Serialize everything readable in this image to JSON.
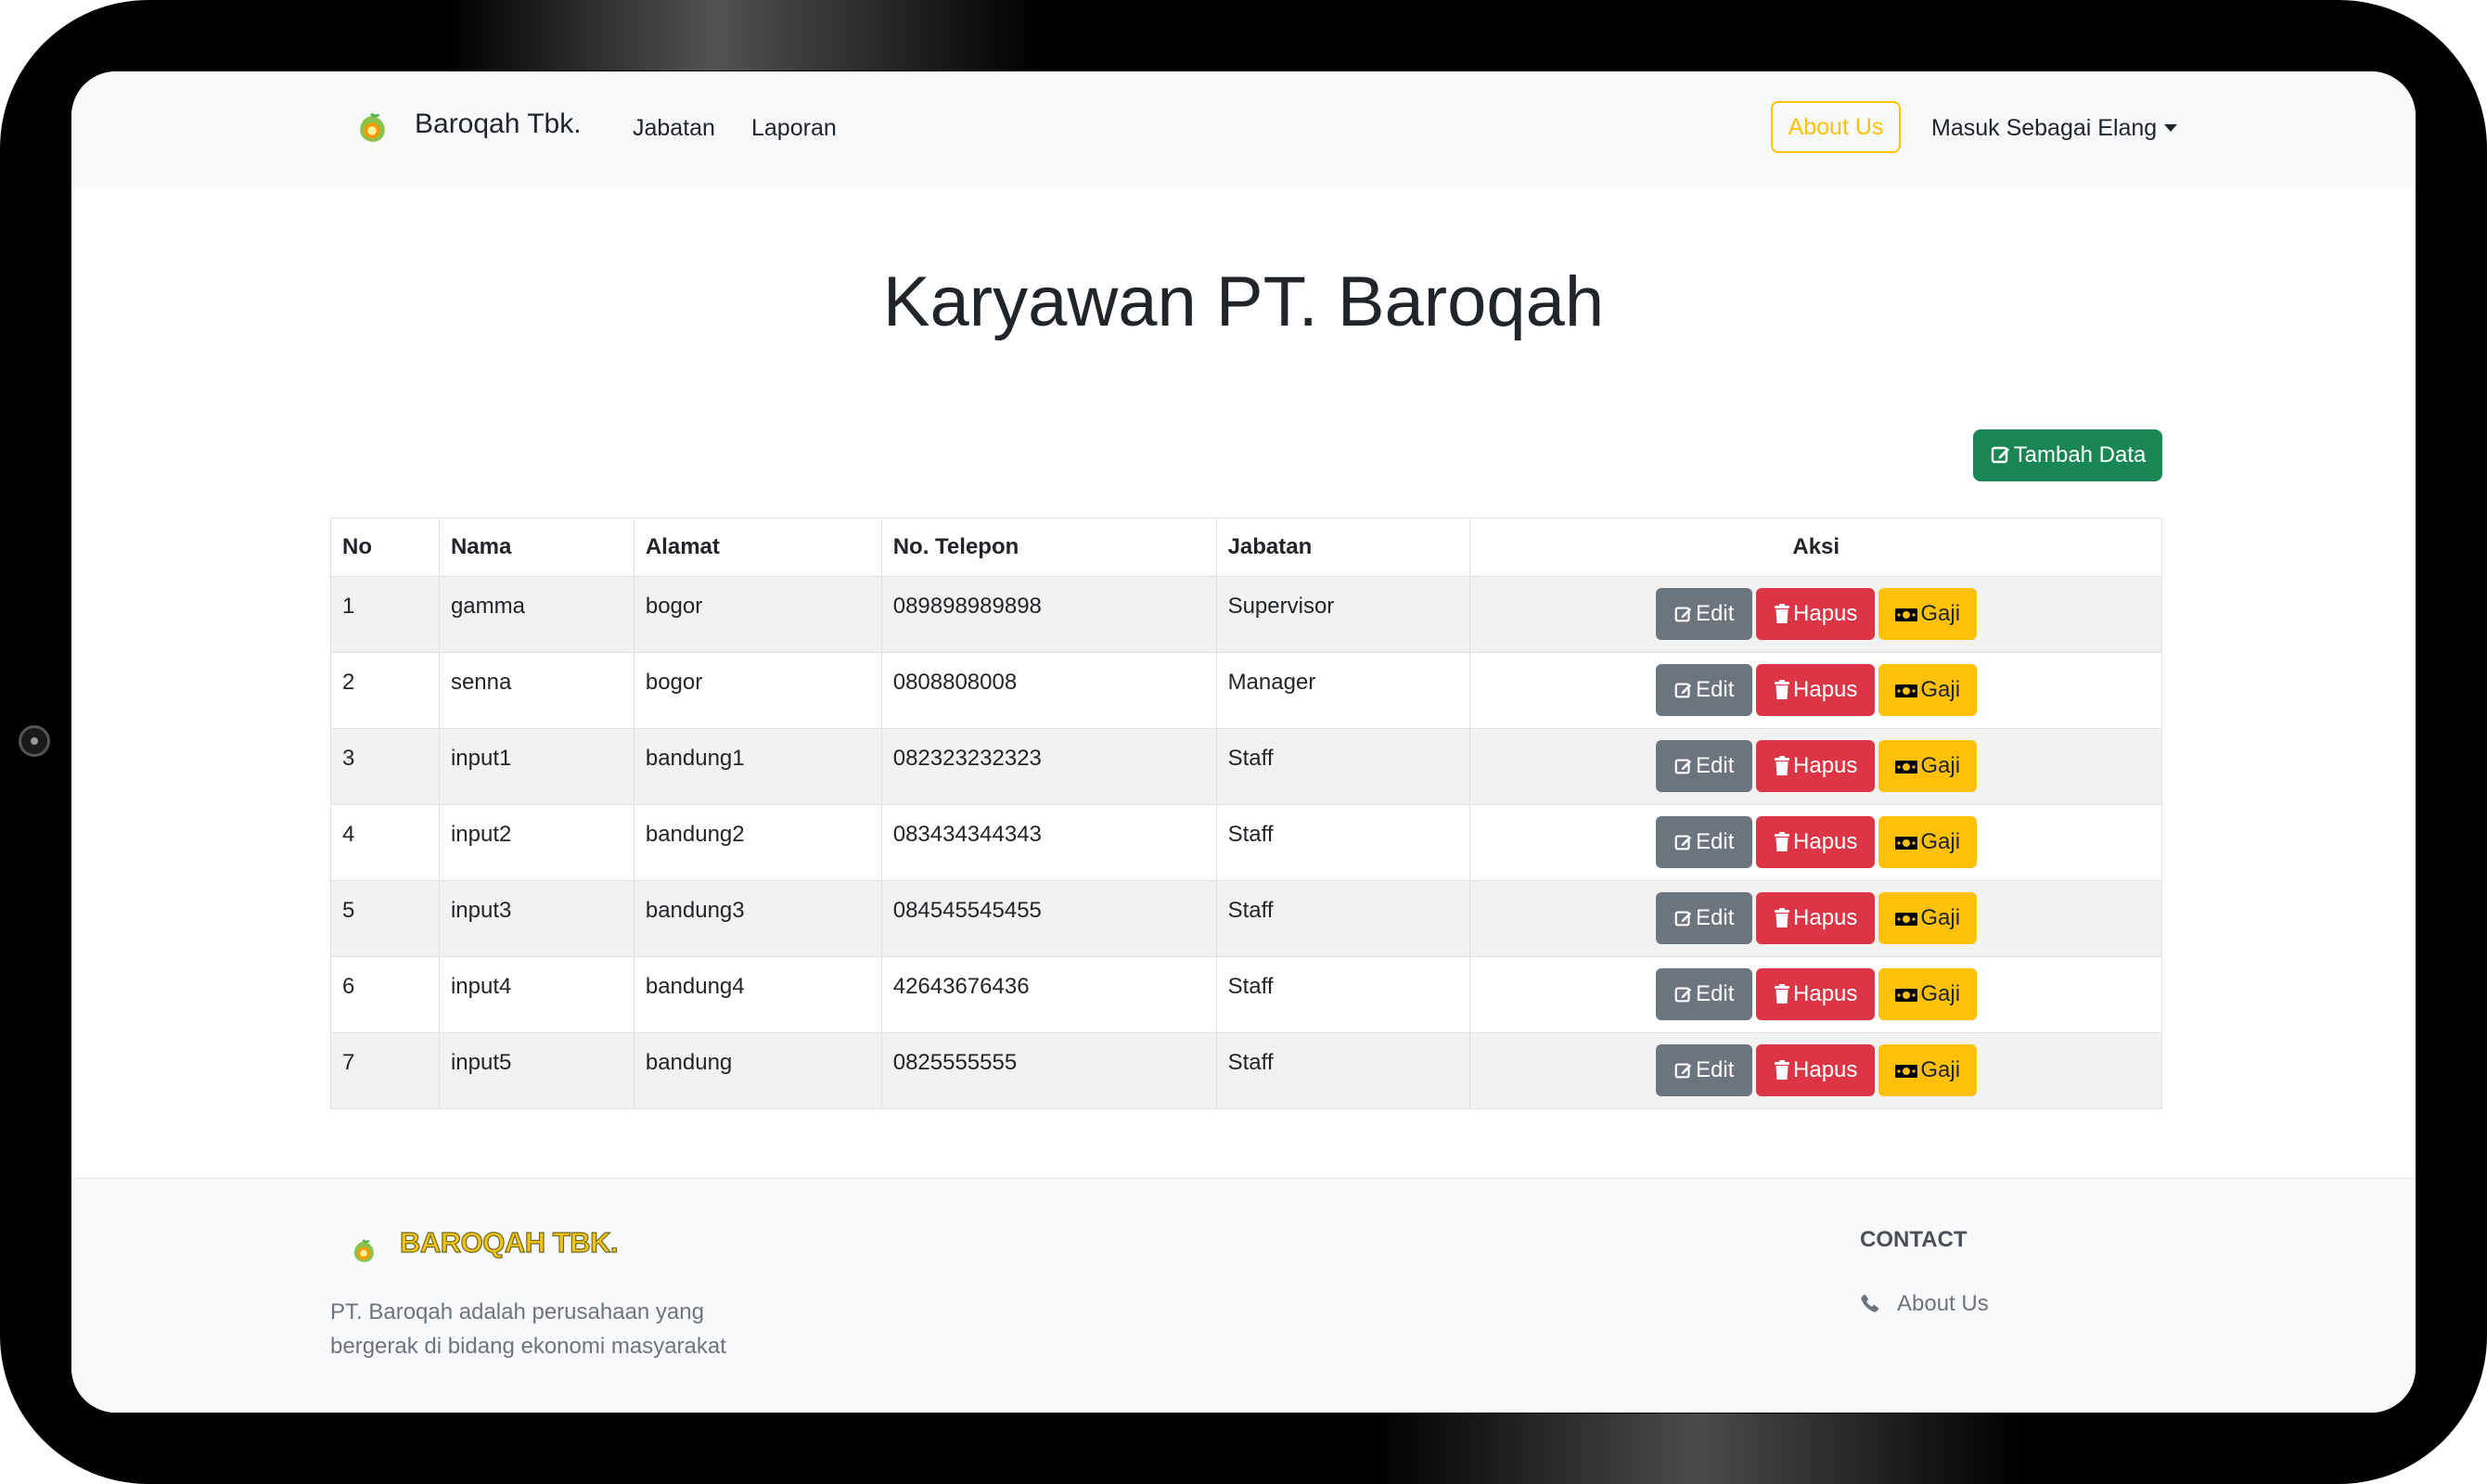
{
  "navbar": {
    "brand": "Baroqah Tbk.",
    "links": [
      "Jabatan",
      "Laporan"
    ],
    "about_button": "About Us",
    "user_menu": "Masuk Sebagai Elang"
  },
  "main": {
    "title": "Karyawan PT. Baroqah",
    "add_button": "Tambah Data",
    "table": {
      "headers": [
        "No",
        "Nama",
        "Alamat",
        "No. Telepon",
        "Jabatan",
        "Aksi"
      ],
      "rows": [
        [
          "1",
          "gamma",
          "bogor",
          "089898989898",
          "Supervisor"
        ],
        [
          "2",
          "senna",
          "bogor",
          "0808808008",
          "Manager"
        ],
        [
          "3",
          "input1",
          "bandung1",
          "082323232323",
          "Staff"
        ],
        [
          "4",
          "input2",
          "bandung2",
          "083434344343",
          "Staff"
        ],
        [
          "5",
          "input3",
          "bandung3",
          "084545545455",
          "Staff"
        ],
        [
          "6",
          "input4",
          "bandung4",
          "42643676436",
          "Staff"
        ],
        [
          "7",
          "input5",
          "bandung",
          "0825555555",
          "Staff"
        ]
      ],
      "actions": [
        "Edit",
        "Hapus",
        "Gaji"
      ]
    }
  },
  "footer": {
    "brand": "BAROQAH TBK.",
    "description": "PT. Baroqah adalah perusahaan yang bergerak di bidang ekonomi masyarakat",
    "contact_heading": "CONTACT",
    "contact_link": "About Us"
  },
  "colors": {
    "add_button": "#198754",
    "edit_button": "#6c757d",
    "hapus_button": "#dc3545",
    "gaji_button": "#ffc107",
    "about_outline": "#ffc107"
  },
  "icons": {
    "brand": "baroqah-logo-icon",
    "add": "edit-square-icon",
    "edit": "edit-square-icon",
    "hapus": "trash-icon",
    "gaji": "money-bill-icon",
    "contact": "phone-icon"
  }
}
